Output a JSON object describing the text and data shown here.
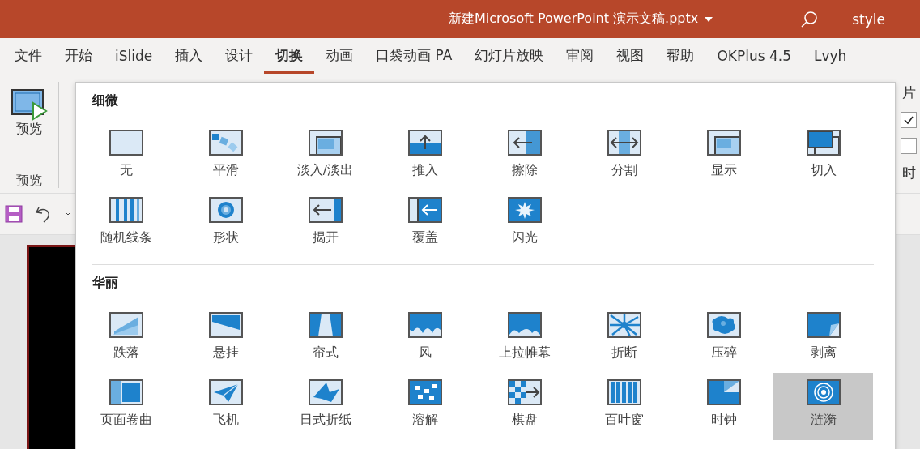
{
  "window": {
    "title": "新建Microsoft PowerPoint 演示文稿.pptx",
    "user": "style"
  },
  "tabs": [
    {
      "label": "文件",
      "selected": false
    },
    {
      "label": "开始",
      "selected": false
    },
    {
      "label": "iSlide",
      "selected": false
    },
    {
      "label": "插入",
      "selected": false
    },
    {
      "label": "设计",
      "selected": false
    },
    {
      "label": "切换",
      "selected": true
    },
    {
      "label": "动画",
      "selected": false
    },
    {
      "label": "口袋动画 PA",
      "selected": false
    },
    {
      "label": "幻灯片放映",
      "selected": false
    },
    {
      "label": "审阅",
      "selected": false
    },
    {
      "label": "视图",
      "selected": false
    },
    {
      "label": "帮助",
      "selected": false
    },
    {
      "label": "OKPlus 4.5",
      "selected": false
    },
    {
      "label": "Lvyh",
      "selected": false
    }
  ],
  "ribbon": {
    "preview_button": "预览",
    "group_label": "预览",
    "right_labels": [
      "片",
      "时"
    ],
    "checkboxes": [
      {
        "checked": true
      },
      {
        "checked": false
      }
    ]
  },
  "gallery": {
    "sections": [
      {
        "title": "细微",
        "items": [
          {
            "label": "无",
            "selected": false
          },
          {
            "label": "平滑",
            "selected": false
          },
          {
            "label": "淡入/淡出",
            "selected": false
          },
          {
            "label": "推入",
            "selected": false
          },
          {
            "label": "擦除",
            "selected": false
          },
          {
            "label": "分割",
            "selected": false
          },
          {
            "label": "显示",
            "selected": false
          },
          {
            "label": "切入",
            "selected": false
          },
          {
            "label": "随机线条",
            "selected": false
          },
          {
            "label": "形状",
            "selected": false
          },
          {
            "label": "揭开",
            "selected": false
          },
          {
            "label": "覆盖",
            "selected": false
          },
          {
            "label": "闪光",
            "selected": false
          }
        ]
      },
      {
        "title": "华丽",
        "items": [
          {
            "label": "跌落",
            "selected": false
          },
          {
            "label": "悬挂",
            "selected": false
          },
          {
            "label": "帘式",
            "selected": false
          },
          {
            "label": "风",
            "selected": false
          },
          {
            "label": "上拉帷幕",
            "selected": false
          },
          {
            "label": "折断",
            "selected": false
          },
          {
            "label": "压碎",
            "selected": false
          },
          {
            "label": "剥离",
            "selected": false
          },
          {
            "label": "页面卷曲",
            "selected": false
          },
          {
            "label": "飞机",
            "selected": false
          },
          {
            "label": "日式折纸",
            "selected": false
          },
          {
            "label": "溶解",
            "selected": false
          },
          {
            "label": "棋盘",
            "selected": false
          },
          {
            "label": "百叶窗",
            "selected": false
          },
          {
            "label": "时钟",
            "selected": false
          },
          {
            "label": "涟漪",
            "selected": true
          }
        ]
      }
    ]
  }
}
